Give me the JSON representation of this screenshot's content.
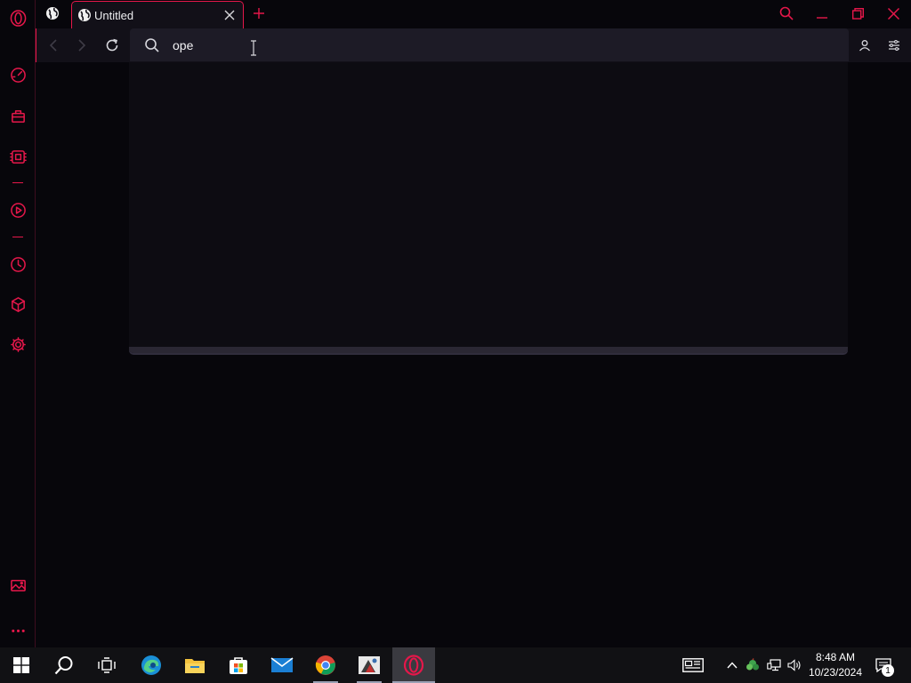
{
  "browser": {
    "accent_color": "#e5174a",
    "tab": {
      "title": "Untitled",
      "favicon": "globe-icon",
      "close_icon": "close-icon"
    },
    "new_tab_icon": "plus-icon",
    "window_controls": [
      "search-icon",
      "minimize-icon",
      "restore-icon",
      "close-icon"
    ],
    "address_bar": {
      "value": "ope",
      "placeholder": ""
    },
    "toolbar_right": [
      "account-icon",
      "easy-setup-icon"
    ]
  },
  "sidebar": {
    "items": [
      "speed-dial-icon",
      "bag-icon",
      "wallet-icon",
      "player-icon",
      "history-icon",
      "extensions-icon",
      "settings-icon",
      "pinboard-icon",
      "more-icon"
    ]
  },
  "taskbar": {
    "apps": [
      "start-icon",
      "search-icon",
      "task-view-icon",
      "edge-icon",
      "file-explorer-icon",
      "store-icon",
      "mail-icon",
      "chrome-icon",
      "app-icon",
      "opera-gx-icon"
    ],
    "clock": {
      "time": "8:48 AM",
      "date": "10/23/2024"
    },
    "notification_count": "1"
  }
}
